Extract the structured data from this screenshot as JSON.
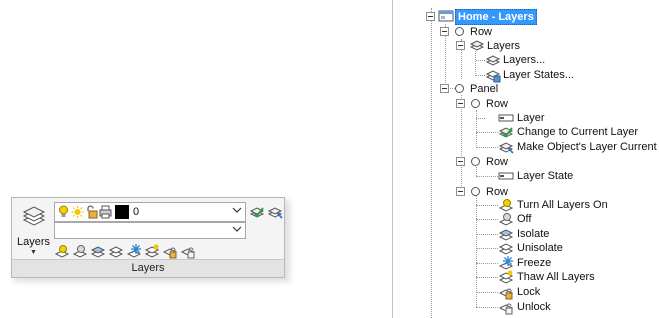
{
  "ribbon": {
    "big_button_label": "Layers",
    "current_layer": "0",
    "panel_title": "Layers"
  },
  "tree": {
    "root": "Home - Layers",
    "row1": "Row",
    "layers_group": "Layers",
    "layers_dialog": "Layers...",
    "layer_states": "Layer States...",
    "panel": "Panel",
    "row2": "Row",
    "layer": "Layer",
    "change_current": "Change to Current Layer",
    "make_object_current": "Make Object's Layer Current",
    "row3": "Row",
    "layer_state": "Layer State",
    "row4": "Row",
    "turn_all_on": "Turn All Layers On",
    "off": "Off",
    "isolate": "Isolate",
    "unisolate": "Unisolate",
    "freeze": "Freeze",
    "thaw_all": "Thaw All Layers",
    "lock": "Lock",
    "unlock": "Unlock"
  },
  "colors": {
    "selection": "#3399ff",
    "layer_color": "#000000",
    "bulb": "#f5d000",
    "check": "#2ea043"
  }
}
